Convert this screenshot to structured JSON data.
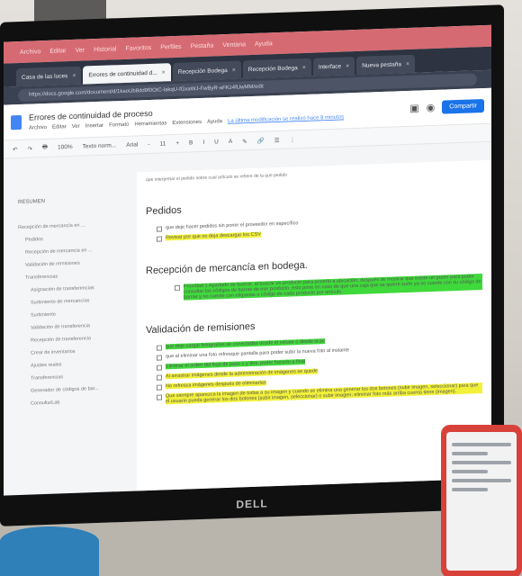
{
  "browser": {
    "menubar": [
      "Archivo",
      "Editar",
      "Ver",
      "Historial",
      "Favoritos",
      "Perfiles",
      "Pestaña",
      "Ventana",
      "Ayuda"
    ],
    "tabs": [
      {
        "label": "Casa de las luces"
      },
      {
        "label": "Errores de continuidad d..."
      },
      {
        "label": "Recepción Bodega"
      },
      {
        "label": "Recepción Bodega"
      },
      {
        "label": "Interface"
      },
      {
        "label": "Nueva pestaña"
      }
    ],
    "url": "https://docs.google.com/document/d/1kaoUb8dd9f0OIC-lakqU-fGxaWJ-FwByR-aFKz4fUwMM/edit"
  },
  "doc": {
    "title": "Errores de continuidad de proceso",
    "menus": [
      "Archivo",
      "Editar",
      "Ver",
      "Insertar",
      "Formato",
      "Herramientas",
      "Extensiones",
      "Ayuda"
    ],
    "last_edit": "La última modificación se realizó hace 8 minutos",
    "share_label": "Compartir",
    "toolbar": [
      "↶",
      "↷",
      "🖶",
      "100%",
      "Texto norm...",
      "Arial",
      "-",
      "11",
      "+",
      "B",
      "I",
      "U",
      "A",
      "✎",
      "🔗",
      "☰",
      "⋮"
    ]
  },
  "outline": {
    "header": "RESUMEN",
    "items": [
      {
        "label": "Recepción de mercancía en ...",
        "level": 1
      },
      {
        "label": "Pedidos",
        "level": 2
      },
      {
        "label": "Recepción de mercancía en ...",
        "level": 2
      },
      {
        "label": "Validación de remisiones",
        "level": 2
      },
      {
        "label": "Transferencias",
        "level": 2
      },
      {
        "label": "Asignación de transferencias",
        "level": 3
      },
      {
        "label": "Surtimiento de mercancías",
        "level": 3
      },
      {
        "label": "Surtimiento",
        "level": 3
      },
      {
        "label": "Validación de transferencia",
        "level": 3
      },
      {
        "label": "Recepción de transferencia",
        "level": 3
      },
      {
        "label": "Crear de inventarios",
        "level": 3
      },
      {
        "label": "Ajustes reales",
        "level": 3
      },
      {
        "label": "Transferencias",
        "level": 3
      },
      {
        "label": "Generador de códigos de bar...",
        "level": 3
      },
      {
        "label": "Consulta/Lab",
        "level": 3
      }
    ]
  },
  "content": {
    "intro": "que interpretar el pedido sobre cual artículo se refiere de la que pedido",
    "sections": [
      {
        "heading": "Pedidos",
        "items": [
          {
            "text": "que deje hacer pedidos sin poner el proveedor en específico",
            "hl": "none"
          },
          {
            "text": "Revisar por que no deja descargar los CSV",
            "hl": "y"
          }
        ]
      },
      {
        "heading": "Recepción de mercancía en bodega.",
        "items": [
          {
            "text": "Prioridad 1 Apartado de buscar, al buscar un producto para ponerlo a ubicación, después de mostrar que existe un poder para poder consultar los códigos de barras de ese producto, esto pone en caso de que una caja que se quiere surtir ya no cuente con su código de barras y no cuente con etiquetas o código de cada producto por artículo.",
            "hl": "g",
            "nested": true
          }
        ]
      },
      {
        "heading": "Validación de remisiones",
        "items": [
          {
            "text": "que deje cargar fotografías se conectadas desde el celular o desde la pc",
            "hl": "g"
          },
          {
            "text": "que al eliminar una foto refresque pantalla para poder subir la nueva foto al instante",
            "hl": "none"
          },
          {
            "text": "Eliminar el orden del flujo de paso 1 y dos, poder hacerlo a final",
            "hl": "g"
          },
          {
            "text": "Al arrastrar imágenes desde la administración de imágenes se quede",
            "hl": "y"
          },
          {
            "text": "No refresca imágenes después de eliminarlas",
            "hl": "y"
          },
          {
            "text": "Que siempre aparezca la imagen de todas a su imagen y cuando se elimina una generar los dos botones (subir imagen, seleccionar) para que el usuario pueda generar los dos botones (subir imagen, seleccionar) o subir imagen; eliminar foto más arriba cuenta tiene (imagen).",
            "hl": "y"
          }
        ]
      }
    ]
  },
  "monitor": {
    "brand": "DELL"
  },
  "colors": {
    "menubar": "#d66a72",
    "highlight_yellow": "#f2f13a",
    "highlight_green": "#3fd93b",
    "share": "#1a73e8"
  }
}
